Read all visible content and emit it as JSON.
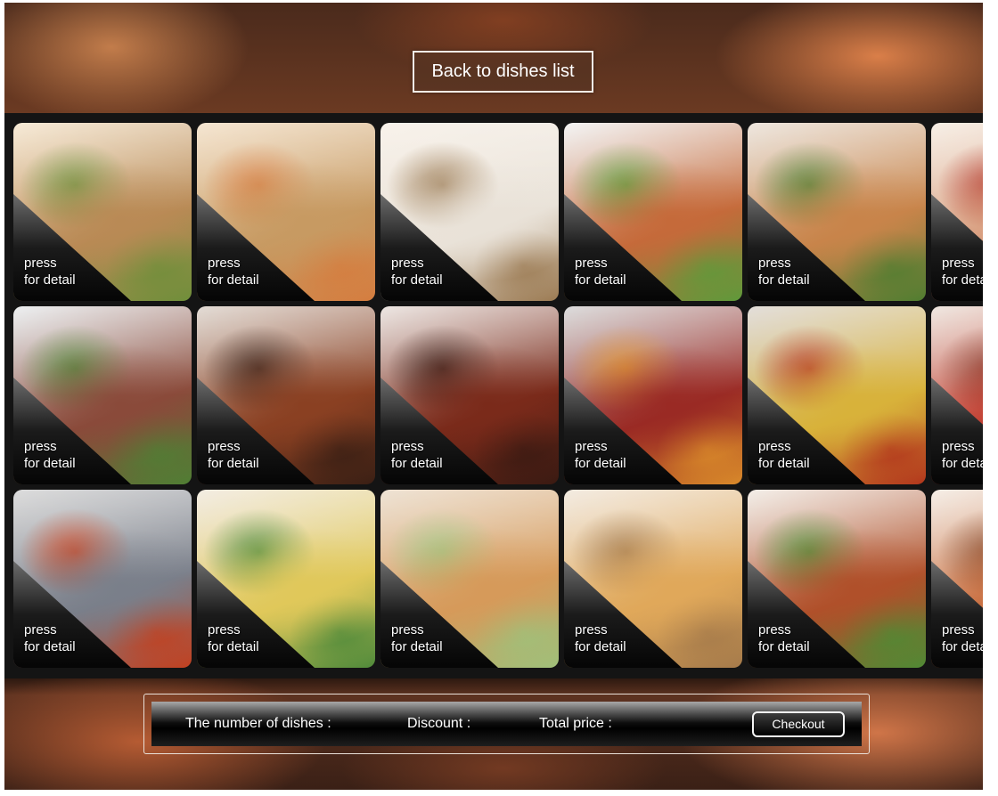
{
  "header": {
    "back_label": "Back to dishes list"
  },
  "tile_label": {
    "line1": "press",
    "line2": "for detail"
  },
  "dishes": [
    {
      "icon": "bento-basket-image",
      "colors": [
        "#f3e2c8",
        "#b98a55",
        "#6f8f3a"
      ]
    },
    {
      "icon": "bento-basket-image",
      "colors": [
        "#f1dcc0",
        "#c79a62",
        "#d57d3f"
      ]
    },
    {
      "icon": "onigiri-image",
      "colors": [
        "#f5ede3",
        "#e9e2d8",
        "#9b7a52"
      ]
    },
    {
      "icon": "fish-sandwich-image",
      "colors": [
        "#efefef",
        "#c56a3a",
        "#5e9a3a"
      ]
    },
    {
      "icon": "bagel-platter-image",
      "colors": [
        "#e7ddd2",
        "#c8844a",
        "#4f7d30"
      ]
    },
    {
      "icon": "sushi-image",
      "colors": [
        "#f4e9dd",
        "#d79a7a",
        "#b43a2a"
      ]
    },
    {
      "icon": "tataki-salad-image",
      "colors": [
        "#e6eaec",
        "#8a4a3a",
        "#4f7f34"
      ]
    },
    {
      "icon": "grilled-eel-image",
      "colors": [
        "#d9cfc6",
        "#8a4022",
        "#3a1f14"
      ]
    },
    {
      "icon": "eel-box-image",
      "colors": [
        "#e6ddd8",
        "#7a2a1a",
        "#3a1a12"
      ]
    },
    {
      "icon": "grilled-beef-image",
      "colors": [
        "#cfcfcf",
        "#9a2a24",
        "#d98a2a"
      ]
    },
    {
      "icon": "barbecue-grill-image",
      "colors": [
        "#d8d2cc",
        "#d8b23a",
        "#b2351c"
      ]
    },
    {
      "icon": "maple-leaf-image",
      "colors": [
        "#eadfd6",
        "#c0392b",
        "#8a3a2a"
      ]
    },
    {
      "icon": "grilled-fish-image",
      "colors": [
        "#cfcfcf",
        "#7a7f8a",
        "#c2401f"
      ]
    },
    {
      "icon": "chirashi-rice-image",
      "colors": [
        "#efe6d8",
        "#e0c85a",
        "#4f8a3a"
      ]
    },
    {
      "icon": "skewers-image",
      "colors": [
        "#e8d8c4",
        "#d69a5a",
        "#9fc07a"
      ]
    },
    {
      "icon": "tofu-bowl-image",
      "colors": [
        "#efe4d6",
        "#e0a85a",
        "#a57a4a"
      ]
    },
    {
      "icon": "crab-hotpot-image",
      "colors": [
        "#efe8e0",
        "#b0502a",
        "#4f8a34"
      ]
    },
    {
      "icon": "steamed-dish-image",
      "colors": [
        "#f2e8de",
        "#c76a3a",
        "#8a4a2a"
      ]
    }
  ],
  "footer": {
    "dishes_label": "The number of dishes :",
    "discount_label": "Discount :",
    "total_label": "Total price :",
    "checkout_label": "Checkout"
  }
}
